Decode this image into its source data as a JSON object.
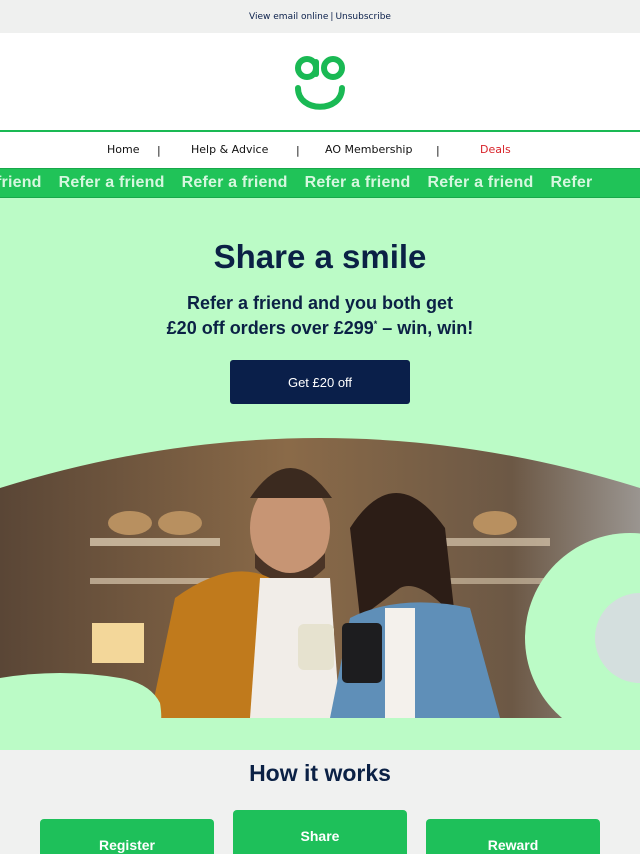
{
  "topbar": {
    "view_online": "View email online",
    "separator": "|",
    "unsubscribe": "Unsubscribe"
  },
  "logo": {
    "name": "ao-smile-logo",
    "color": "#1ab954"
  },
  "nav": {
    "items": [
      "Home",
      "Help & Advice",
      "AO Membership",
      "Deals"
    ],
    "separator": "|",
    "deals_color": "#d8232a"
  },
  "ticker": {
    "items": [
      "friend",
      "Refer a friend",
      "Refer a friend",
      "Refer a friend",
      "Refer a friend",
      "Refer"
    ]
  },
  "hero": {
    "title": "Share a smile",
    "sub_line1": "Refer a friend and you both get",
    "sub_line2_pre": "£20 off orders over £299",
    "sub_line2_sup": "*",
    "sub_line2_post": " – win, win!",
    "cta_label": "Get £20 off",
    "background": "#bbfbc6",
    "cta_color": "#0a1f4a"
  },
  "how_it_works": {
    "title": "How it works",
    "steps": [
      "Register",
      "Share",
      "Reward"
    ],
    "step_color": "#1ec05a"
  }
}
